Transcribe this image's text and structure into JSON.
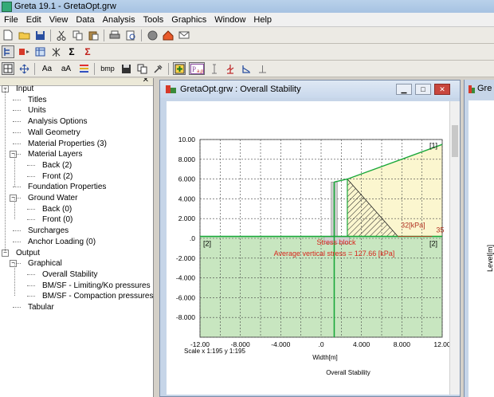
{
  "app": {
    "title": "Greta 19.1 - GretaOpt.grw"
  },
  "menu": [
    "File",
    "Edit",
    "View",
    "Data",
    "Analysis",
    "Tools",
    "Graphics",
    "Window",
    "Help"
  ],
  "toolbar3": {
    "bmp_label": "bmp",
    "aa1_label": "Aa",
    "aa2_label": "aA"
  },
  "tree": [
    {
      "label": "Input",
      "level": 0,
      "toggle": "−"
    },
    {
      "label": "Titles",
      "level": 1
    },
    {
      "label": "Units",
      "level": 1
    },
    {
      "label": "Analysis Options",
      "level": 1
    },
    {
      "label": "Wall Geometry",
      "level": 1
    },
    {
      "label": "Material Properties (3)",
      "level": 1
    },
    {
      "label": "Material Layers",
      "level": 1,
      "toggle": "−"
    },
    {
      "label": "Back (2)",
      "level": 2
    },
    {
      "label": "Front (2)",
      "level": 2
    },
    {
      "label": "Foundation Properties",
      "level": 1
    },
    {
      "label": "Ground Water",
      "level": 1,
      "toggle": "−"
    },
    {
      "label": "Back (0)",
      "level": 2
    },
    {
      "label": "Front (0)",
      "level": 2
    },
    {
      "label": "Surcharges",
      "level": 1
    },
    {
      "label": "Anchor Loading (0)",
      "level": 1
    },
    {
      "label": "Output",
      "level": 0,
      "toggle": "−"
    },
    {
      "label": "Graphical",
      "level": 1,
      "toggle": "−"
    },
    {
      "label": "Overall Stability",
      "level": 2
    },
    {
      "label": "BM/SF - Limiting/Ko pressures",
      "level": 2
    },
    {
      "label": "BM/SF - Compaction pressures",
      "level": 2
    },
    {
      "label": "Tabular",
      "level": 1
    }
  ],
  "doc_window": {
    "title": "GretaOpt.grw : Overall Stability",
    "ctrl_min": "▁",
    "ctrl_max": "□",
    "ctrl_close": "✕"
  },
  "doc_window2": {
    "title": "Gre",
    "ylabel": "Level[m]"
  },
  "plot": {
    "y_ticks": [
      "10.00",
      "8.000",
      "6.000",
      "4.000",
      "2.000",
      ".0",
      "-2.000",
      "-4.000",
      "-6.000",
      "-8.000"
    ],
    "x_ticks": [
      "-12.00",
      "-8.000",
      "-4.000",
      ".0",
      "4.000",
      "8.000",
      "12.00"
    ],
    "xlabel": "Width[m]",
    "scale": "Scale x 1:195  y 1:195",
    "bottom_title": "Overall Stability",
    "label_left_ground": "[2]",
    "label_right_ground": "[2]",
    "label_top_right": "[1]",
    "pressure_label": "32[kPa]",
    "pressure_label2": "35",
    "stress_block": "Stress block",
    "average_stress": "Average vertical stress = 127.66 [kPa]",
    "colors": {
      "upper_fill": "#fbf6cf",
      "lower_fill": "#c8e6c0",
      "green_line": "#1aa83a",
      "red_text": "#d8261c",
      "wall": "#cfcfcf",
      "grid": "#444444"
    }
  }
}
